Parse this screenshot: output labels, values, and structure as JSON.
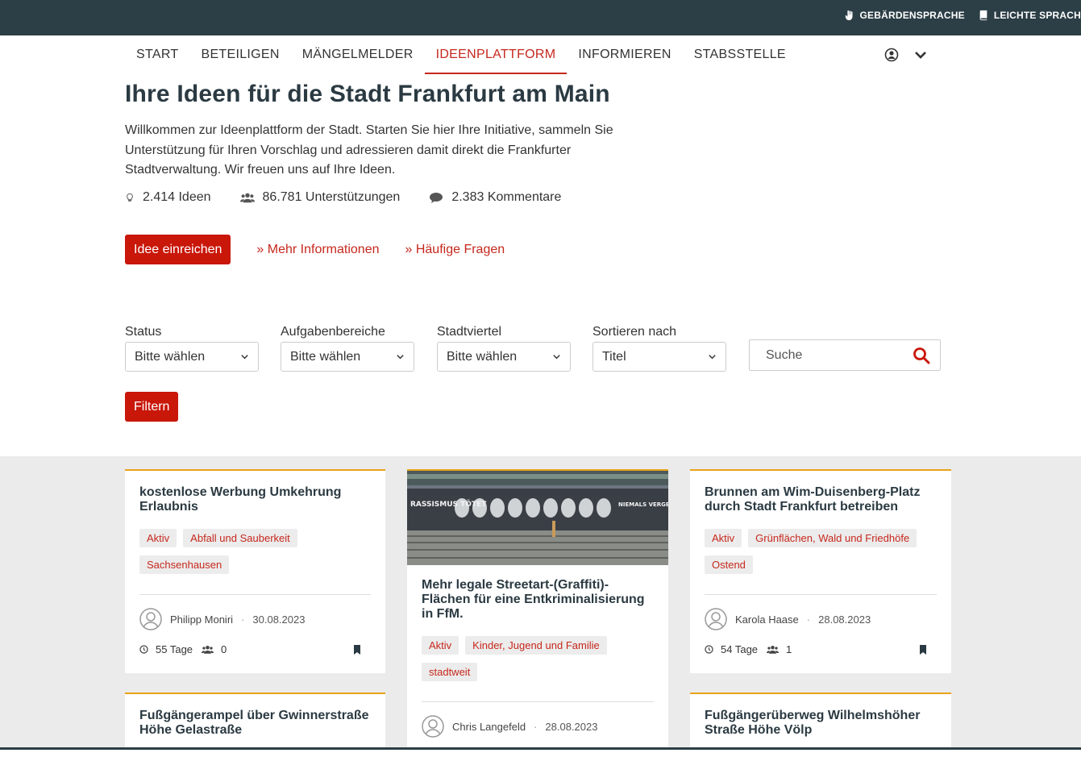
{
  "topbar": {
    "sign_language": "GEBÄRDENSPRACHE",
    "easy_language": "LEICHTE SPRACH"
  },
  "nav": {
    "items": [
      "START",
      "BETEILIGEN",
      "MÄNGELMELDER",
      "IDEENPLATTFORM",
      "INFORMIEREN",
      "STABSSTELLE"
    ],
    "active_index": 3
  },
  "hero": {
    "title": "Ihre Ideen für die Stadt Frankfurt am Main",
    "intro": "Willkommen zur Ideenplattform der Stadt. Starten Sie hier Ihre Initiative, sammeln Sie Unterstützung für Ihren Vorschlag und adressieren damit direkt die Frankfurter Stadtverwaltung. Wir freuen uns auf Ihre Ideen."
  },
  "stats": {
    "ideas": "2.414 Ideen",
    "supports": "86.781 Unterstützungen",
    "comments": "2.383 Kommentare"
  },
  "actions": {
    "submit": "Idee einreichen",
    "more_info": "» Mehr Informationen",
    "faq": "» Häufige Fragen"
  },
  "filters": {
    "status_label": "Status",
    "status_value": "Bitte wählen",
    "areas_label": "Aufgabenbereiche",
    "areas_value": "Bitte wählen",
    "district_label": "Stadtviertel",
    "district_value": "Bitte wählen",
    "sort_label": "Sortieren nach",
    "sort_value": "Titel",
    "search_placeholder": "Suche",
    "filter_button": "Filtern"
  },
  "cards": [
    {
      "title": "kostenlose Werbung Umkehrung Erlaubnis",
      "tags": [
        "Aktiv",
        "Abfall und Sauberkeit",
        "Sachsenhausen"
      ],
      "author": "Philipp Moniri",
      "date": "30.08.2023",
      "days": "55 Tage",
      "supporters": "0"
    },
    {
      "title": "Mehr legale Streetart-(Graffiti)-Flächen für eine Entkriminalisierung in FfM.",
      "tags": [
        "Aktiv",
        "Kinder, Jugend und Familie",
        "stadtweit"
      ],
      "author": "Chris Langefeld",
      "date": "28.08.2023",
      "image_text_left": "RASSISMUS TÖTET",
      "image_text_right": "NIEMALS VERGESSEN"
    },
    {
      "title": "Brunnen am Wim-Duisenberg-Platz durch Stadt Frankfurt betreiben",
      "tags": [
        "Aktiv",
        "Grünflächen, Wald und Friedhöfe",
        "Ostend"
      ],
      "author": "Karola Haase",
      "date": "28.08.2023",
      "days": "54 Tage",
      "supporters": "1"
    },
    {
      "title": "Fußgängerampel über Gwinnerstraße Höhe Gelastraße"
    },
    {
      "title": "Fußgängerüberweg Wilhelmshöher Straße Höhe Völp"
    }
  ]
}
